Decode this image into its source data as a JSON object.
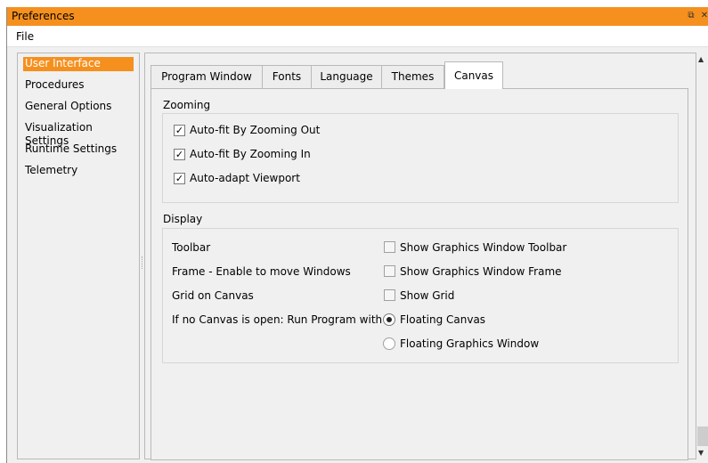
{
  "window": {
    "title": "Preferences",
    "restore_glyph": "⧉",
    "close_glyph": "✕",
    "accent_color": "#f5901e"
  },
  "menu": {
    "file": "File"
  },
  "sidebar": {
    "items": [
      {
        "label": "User Interface",
        "selected": true
      },
      {
        "label": "Procedures"
      },
      {
        "label": "General Options"
      },
      {
        "label": "Visualization Settings"
      },
      {
        "label": "Runtime Settings"
      },
      {
        "label": "Telemetry"
      }
    ]
  },
  "tabs": [
    {
      "label": "Program Window"
    },
    {
      "label": "Fonts"
    },
    {
      "label": "Language"
    },
    {
      "label": "Themes"
    },
    {
      "label": "Canvas",
      "active": true
    }
  ],
  "zooming": {
    "heading": "Zooming",
    "options": [
      {
        "label": "Auto-fit By Zooming Out",
        "checked": true
      },
      {
        "label": "Auto-fit By Zooming In",
        "checked": true
      },
      {
        "label": "Auto-adapt Viewport",
        "checked": true
      }
    ]
  },
  "display": {
    "heading": "Display",
    "rows": [
      {
        "label": "Toolbar",
        "option": "Show Graphics Window Toolbar",
        "checked": false
      },
      {
        "label": "Frame - Enable to move Windows",
        "option": "Show Graphics Window Frame",
        "checked": false
      },
      {
        "label": "Grid on Canvas",
        "option": "Show Grid",
        "checked": false
      }
    ],
    "run_label": "If no Canvas is open: Run Program with",
    "run_options": [
      {
        "label": "Floating Canvas",
        "selected": true
      },
      {
        "label": "Floating Graphics Window",
        "selected": false
      }
    ],
    "check_glyph": "✓"
  },
  "scrollbar": {
    "up_glyph": "▲",
    "down_glyph": "▼"
  }
}
